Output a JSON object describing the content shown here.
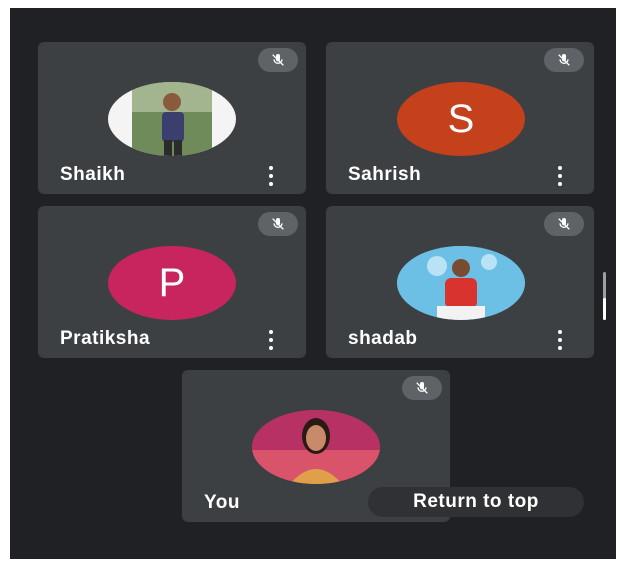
{
  "participants": [
    {
      "name": "Shaikh",
      "avatar": "photo",
      "avatar_bg": "#f4f4f4",
      "muted": true
    },
    {
      "name": "Sahrish",
      "avatar": "letter",
      "letter": "S",
      "avatar_bg": "#c4411c",
      "muted": true
    },
    {
      "name": "Pratiksha",
      "avatar": "letter",
      "letter": "P",
      "avatar_bg": "#c8255f",
      "muted": true
    },
    {
      "name": "shadab",
      "avatar": "photo",
      "avatar_bg": "#4fa9d6",
      "muted": true
    },
    {
      "name": "You",
      "avatar": "photo",
      "avatar_bg": "#c23b6b",
      "muted": true
    }
  ],
  "return_to_top": {
    "label": "Return to top"
  },
  "icons": {
    "mute": "mic-off-icon",
    "menu": "more-vert-icon"
  },
  "colors": {
    "background": "#202124",
    "tile": "#3c4043",
    "mute_badge": "#5f6368"
  }
}
